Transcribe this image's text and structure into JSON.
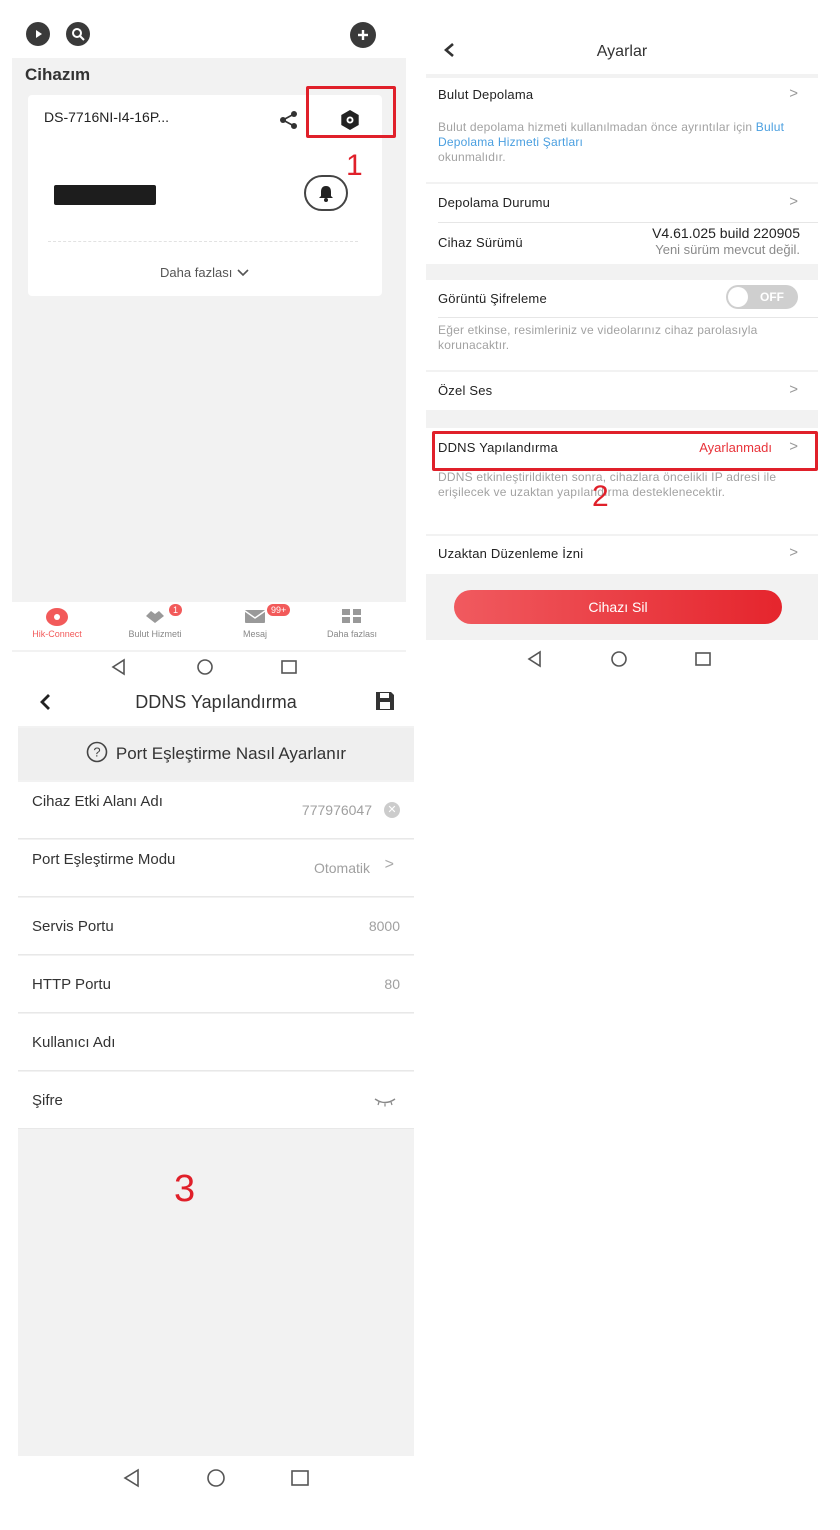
{
  "panel1": {
    "title": "Cihazım",
    "device_name": "DS-7716NI-I4-16P...",
    "more_label": "Daha fazlası",
    "tabs": [
      {
        "label": "Hik-Connect",
        "badge": ""
      },
      {
        "label": "Bulut Hizmeti",
        "badge": "1"
      },
      {
        "label": "Mesaj",
        "badge": "99+"
      },
      {
        "label": "Daha fazlası",
        "badge": ""
      }
    ],
    "accent_color": "#f25a5a"
  },
  "panel2": {
    "title": "Ayarlar",
    "cloud_storage_label": "Bulut Depolama",
    "cloud_desc_part1": "Bulut depolama hizmeti kullanılmadan önce ayrıntılar için ",
    "cloud_desc_link": "Bulut Depolama Hizmeti Şartları",
    "cloud_desc_part2": "okunmalıdır.",
    "storage_status_label": "Depolama Durumu",
    "device_version_label": "Cihaz Sürümü",
    "version_value": "V4.61.025 build 220905",
    "version_note": "Yeni sürüm mevcut değil.",
    "image_encryption_label": "Görüntü Şifreleme",
    "toggle_state": "OFF",
    "encryption_desc": "Eğer etkinse, resimleriniz ve videolarınız cihaz parolasıyla korunacaktır.",
    "custom_voice_label": "Özel Ses",
    "ddns_label": "DDNS Yapılandırma",
    "ddns_status": "Ayarlanmadı",
    "ddns_desc": "DDNS etkinleştirildikten sonra, cihazlara öncelikli IP adresi ile erişilecek ve uzaktan yapılandırma desteklenecektir.",
    "remote_config_label": "Uzaktan Düzenleme İzni",
    "delete_button": "Cihazı Sil",
    "link_color": "#4a9fe0",
    "danger_color": "#e8333a"
  },
  "panel3": {
    "title": "DDNS Yapılandırma",
    "help_text": "Port Eşleştirme Nasıl Ayarlanır",
    "fields": [
      {
        "label": "Cihaz Etki Alanı Adı",
        "value": "777976047"
      },
      {
        "label": "Port Eşleştirme Modu",
        "value": "Otomatik"
      },
      {
        "label": "Servis Portu",
        "value": "8000"
      },
      {
        "label": "HTTP Portu",
        "value": "80"
      },
      {
        "label": "Kullanıcı Adı",
        "value": ""
      },
      {
        "label": "Şifre",
        "value": ""
      }
    ]
  },
  "annotations": {
    "step1": "1",
    "step2": "2",
    "step3": "3",
    "color": "#e0202a"
  }
}
